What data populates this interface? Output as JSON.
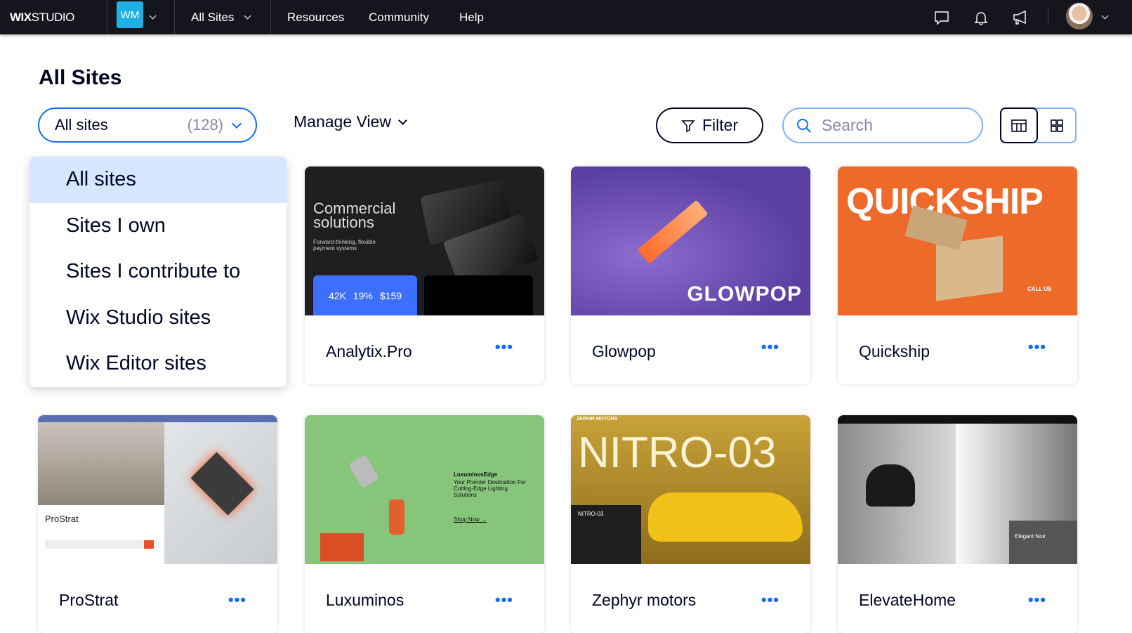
{
  "topbar": {
    "logo": "WIX STUDIO",
    "logo_bold": "WIX",
    "logo_light": "STUDIO",
    "workspace_initials": "WM",
    "workspace_color": "#1fb1e6",
    "all_sites_menu": "All Sites",
    "nav": [
      "Resources",
      "Community",
      "Help"
    ],
    "icons": [
      "chat-icon",
      "bell-icon",
      "megaphone-icon"
    ]
  },
  "page": {
    "title": "All Sites"
  },
  "controls": {
    "site_filter": {
      "value": "All sites",
      "count": "(128)"
    },
    "manage_view": "Manage View",
    "filter": "Filter",
    "search_placeholder": "Search",
    "view_toggle": {
      "selected": "table"
    }
  },
  "dropdown": {
    "options": [
      "All sites",
      "Sites I own",
      "Sites I contribute to",
      "Wix Studio sites",
      "Wix Editor sites"
    ],
    "selected": "All sites"
  },
  "accent": "#116dff",
  "sites": [
    {
      "name": "Analytix.Pro",
      "thumb": {
        "headline": "Commercial solutions",
        "sub": "Forward-thinking, flexible payment systems",
        "stats": [
          "42K",
          "19%",
          "$159"
        ]
      }
    },
    {
      "name": "Glowpop",
      "thumb": {
        "headline": "GLOWPOP"
      }
    },
    {
      "name": "Quickship",
      "thumb": {
        "headline": "QUICKSHIP",
        "sub": "CALL US"
      }
    },
    {
      "name": "ProStrat",
      "thumb": {
        "headline": "ProStrat"
      }
    },
    {
      "name": "Luxuminos",
      "thumb": {
        "headline": "LuxuminosEdge",
        "sub": "Your Premier Destination For Cutting-Edge Lighting Solutions",
        "cta": "Shop Now →"
      }
    },
    {
      "name": "Zephyr motors",
      "thumb": {
        "headline": "NITRO-03",
        "brand": "ZEPHIR MOTORS"
      }
    },
    {
      "name": "ElevateHome",
      "thumb": {
        "headline": "Elegant Noir"
      }
    }
  ],
  "more_label": "•••"
}
